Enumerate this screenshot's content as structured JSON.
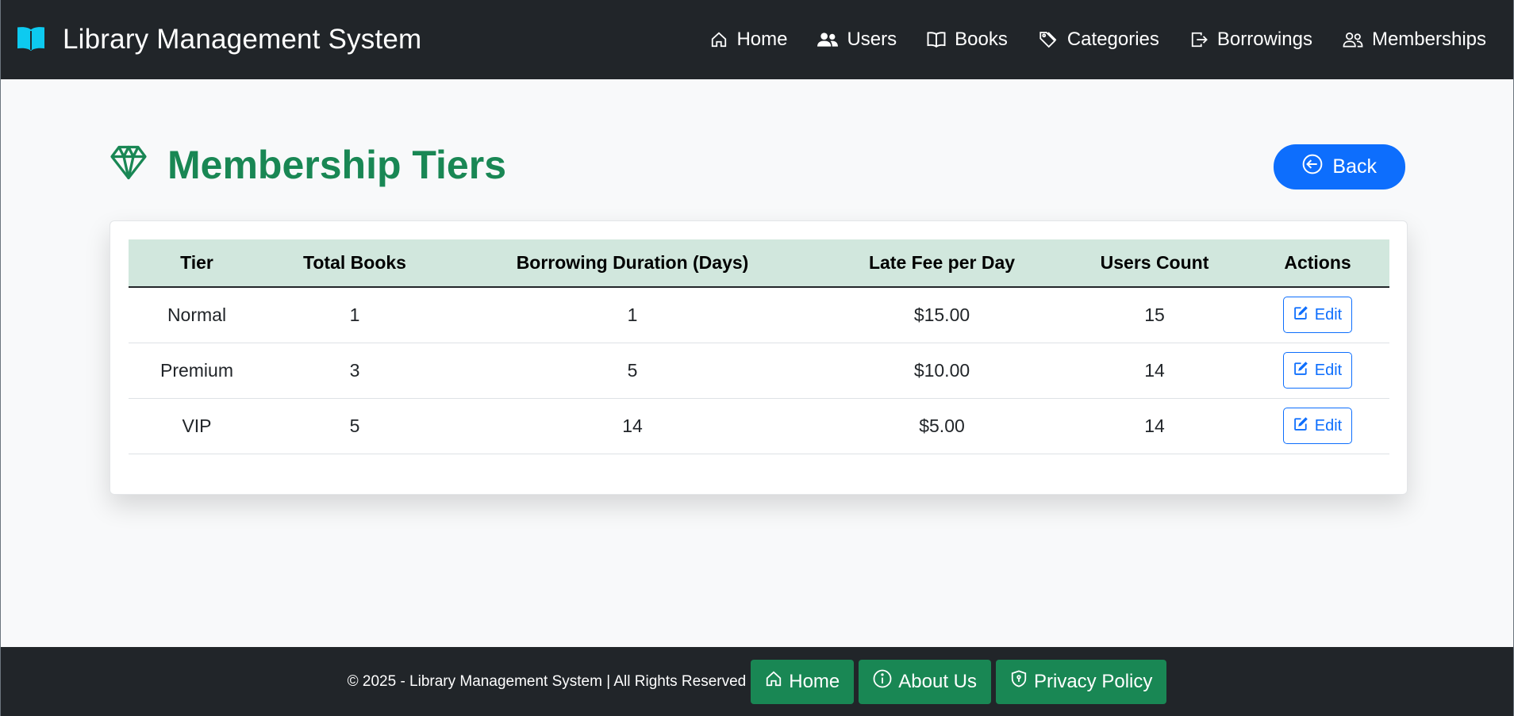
{
  "navbar": {
    "brand": "Library Management System",
    "brand_icon": "open-book-icon",
    "items": [
      {
        "label": "Home",
        "icon": "house-icon"
      },
      {
        "label": "Users",
        "icon": "people-icon"
      },
      {
        "label": "Books",
        "icon": "book-icon"
      },
      {
        "label": "Categories",
        "icon": "tags-icon"
      },
      {
        "label": "Borrowings",
        "icon": "box-arrow-right-icon"
      },
      {
        "label": "Memberships",
        "icon": "people-outline-icon"
      }
    ]
  },
  "page": {
    "title": "Membership Tiers",
    "title_icon": "gem-icon",
    "back_label": "Back"
  },
  "table": {
    "headers": [
      "Tier",
      "Total Books",
      "Borrowing Duration (Days)",
      "Late Fee per Day",
      "Users Count",
      "Actions"
    ],
    "rows": [
      {
        "tier": "Normal",
        "total_books": "1",
        "duration": "1",
        "late_fee": "$15.00",
        "users": "15",
        "action": "Edit"
      },
      {
        "tier": "Premium",
        "total_books": "3",
        "duration": "5",
        "late_fee": "$10.00",
        "users": "14",
        "action": "Edit"
      },
      {
        "tier": "VIP",
        "total_books": "5",
        "duration": "14",
        "late_fee": "$5.00",
        "users": "14",
        "action": "Edit"
      }
    ]
  },
  "footer": {
    "copyright": "© 2025 - Library Management System | All Rights Reserved",
    "links": [
      {
        "label": "Home",
        "icon": "house-icon"
      },
      {
        "label": "About Us",
        "icon": "info-circle-icon"
      },
      {
        "label": "Privacy Policy",
        "icon": "shield-icon"
      }
    ]
  },
  "colors": {
    "navbar_bg": "#212529",
    "brand_icon": "#0dcaf0",
    "title_green": "#198754",
    "primary_blue": "#0d6efd",
    "table_header_bg": "#d1e7dd"
  }
}
